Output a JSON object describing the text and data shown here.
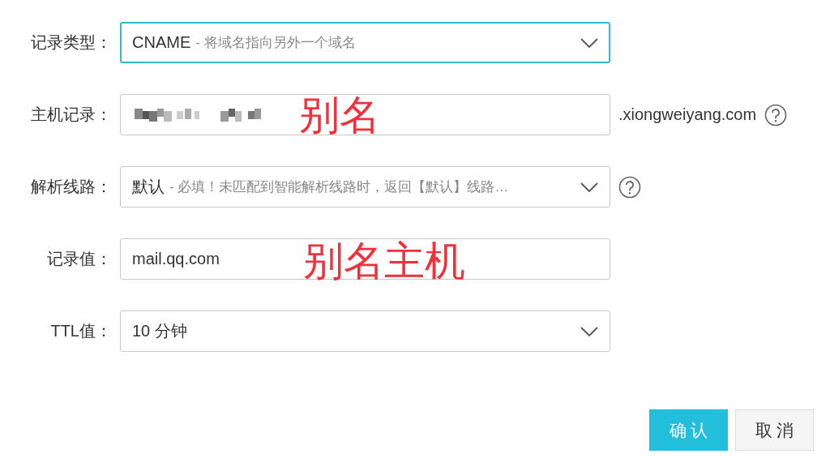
{
  "form": {
    "rows": [
      {
        "label": "记录类型：",
        "kind": "select",
        "value": "CNAME",
        "hint": "- 将域名指向另外一个域名",
        "focused": true
      },
      {
        "label": "主机记录：",
        "kind": "input",
        "redacted": true,
        "annotation": "别名",
        "suffix": ".xiongweiyang.com",
        "help": true,
        "focused": false
      },
      {
        "label": "解析线路：",
        "kind": "select",
        "value": "默认",
        "hint": "- 必填！未匹配到智能解析线路时，返回【默认】线路…",
        "help": true,
        "focused": false
      },
      {
        "label": "记录值：",
        "kind": "input",
        "value": "mail.qq.com",
        "annotation": "别名主机",
        "focused": false
      },
      {
        "label": "TTL值：",
        "kind": "select",
        "value": "10 分钟",
        "focused": false
      }
    ]
  },
  "buttons": [
    {
      "label": "确 认",
      "kind": "primary"
    },
    {
      "label": "取 消",
      "kind": "default"
    }
  ]
}
